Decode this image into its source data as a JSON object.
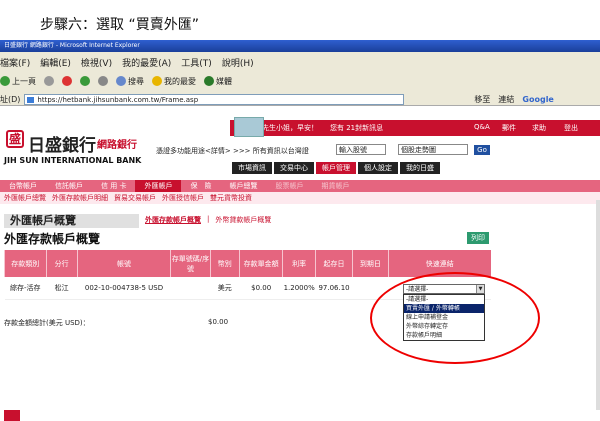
{
  "caption": "步驟六：選取 “買賣外匯”",
  "window_title": "日盛銀行 網路銀行 - Microsoft Internet Explorer",
  "menu": [
    "檔案(F)",
    "編輯(E)",
    "檢視(V)",
    "我的最愛(A)",
    "工具(T)",
    "說明(H)"
  ],
  "toolbar": {
    "back": "上一頁",
    "search": "搜尋",
    "favorites": "我的最愛",
    "media": "媒體"
  },
  "address": {
    "label": "址(D)",
    "url": "https://hetbank.jihsunbank.com.tw/Frame.asp",
    "go": "移至",
    "links": "連結",
    "google": "Google"
  },
  "bank": {
    "logo_char": "盛",
    "name": "日盛銀行",
    "sub": "網路銀行",
    "english": "JIH SUN INTERNATIONAL BANK",
    "greeting": "先生小姐，早安！",
    "messages": "您有 21封新訊息",
    "qa": "Q&A",
    "mailbox": "郵件",
    "help": "求助",
    "logout": "登出",
    "tagline": "憑證多功能用途<詳情> >>> 所有資訊以台灣證",
    "input_label": "輸入股號",
    "stock_select": "個股走勢圖",
    "go": "Go"
  },
  "nav_tabs": [
    "市場資訊",
    "交易中心",
    "帳戶管理",
    "個人設定",
    "我的日盛"
  ],
  "main_nav": [
    "台幣帳戶",
    "信託帳戶",
    "信 用 卡",
    "外匯帳戶",
    "保　險",
    "帳戶總覽",
    "股票帳戶",
    "期貨帳戶"
  ],
  "sub_nav": [
    "外匯帳戶總覽",
    "外匯存款帳戶明細",
    "貿易交易帳戶",
    "外匯授信帳戶",
    "雙元貨幣投資"
  ],
  "section": {
    "tab": "外匯帳戶概覽",
    "link1": "外匯存款帳戶概覽",
    "sep": "|",
    "link2": "外幣貸款帳戶概覽"
  },
  "page_title": "外匯存款帳戶概覽",
  "print_label": "列印",
  "table": {
    "headers": [
      "存款類別",
      "分行",
      "帳號",
      "存單號碼/序號",
      "幣別",
      "存款單金額",
      "利率",
      "起存日",
      "到期日",
      "快速連結"
    ],
    "row": {
      "type": "綜存-活存",
      "branch": "松江",
      "account": "002-10-004738-5 USD",
      "cert": "",
      "currency": "美元",
      "amount": "$0.00",
      "rate": "1.2000%",
      "start": "97.06.10",
      "end": ""
    }
  },
  "total_label": "存款金額總計(美元 USD)：",
  "total_value": "$0.00",
  "quick_select": {
    "value": "-請選擇-",
    "options": [
      "-請選擇-",
      "買賣外匯 / 外幣轉帳",
      "線上申請補登金",
      "外幣綜存轉定存",
      "存款帳戶明細"
    ]
  },
  "colors": {
    "accent": "#c8102e",
    "header_pink": "#e5657f",
    "highlight": "#0a246a"
  }
}
